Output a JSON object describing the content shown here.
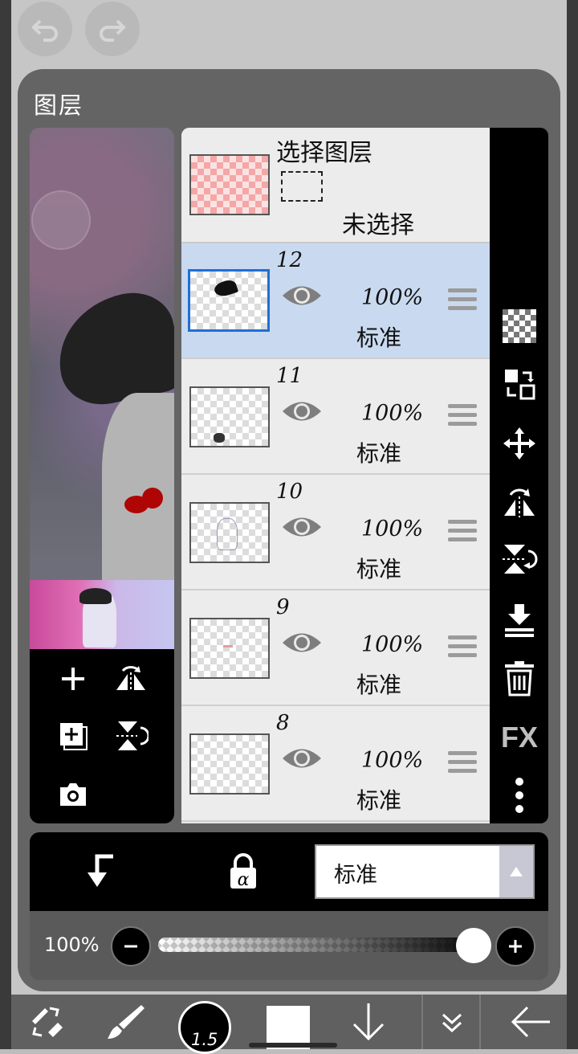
{
  "topbar": {
    "undo_icon": "undo-icon",
    "redo_icon": "redo-icon"
  },
  "panel": {
    "title": "图层"
  },
  "selection_row": {
    "title": "选择图层",
    "status": "未选择"
  },
  "layers": [
    {
      "number": "12",
      "opacity": "100%",
      "mode": "标准",
      "selected": true
    },
    {
      "number": "11",
      "opacity": "100%",
      "mode": "标准",
      "selected": false
    },
    {
      "number": "10",
      "opacity": "100%",
      "mode": "标准",
      "selected": false
    },
    {
      "number": "9",
      "opacity": "100%",
      "mode": "标准",
      "selected": false
    },
    {
      "number": "8",
      "opacity": "100%",
      "mode": "标准",
      "selected": false
    }
  ],
  "right_toolbar": {
    "fx_label": "FX"
  },
  "blend": {
    "mode_label": "标准"
  },
  "opacity": {
    "label": "100%",
    "value_fraction": 1.0
  },
  "bottom_toolbar": {
    "brush_size": "1.5"
  },
  "colors": {
    "accent_blue": "#1f6fd6",
    "selected_row": "#c9daf0",
    "panel_bg": "#646464",
    "toolbar_bg": "#000000"
  }
}
